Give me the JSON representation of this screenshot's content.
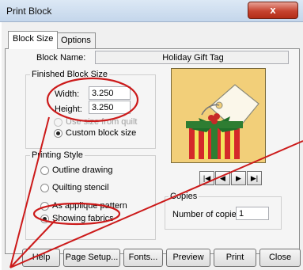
{
  "window": {
    "title": "Print Block",
    "close_glyph": "x"
  },
  "tabs": [
    {
      "label": "Block Size",
      "active": true
    },
    {
      "label": "Options",
      "active": false
    }
  ],
  "block": {
    "name_label": "Block Name:",
    "name_value": "Holiday Gift Tag"
  },
  "finished_size": {
    "legend": "Finished Block Size",
    "width_label": "Width:",
    "width_value": "3.250",
    "height_label": "Height:",
    "height_value": "3.250",
    "use_quilt_label": "Use size from quilt",
    "custom_label": "Custom block size",
    "selected": "custom"
  },
  "printing_style": {
    "legend": "Printing Style",
    "options": [
      "Outline drawing",
      "Quilting stencil",
      "As applique pattern",
      "Showing fabrics"
    ],
    "selected_index": 3
  },
  "navigation": {
    "icons": [
      "first-icon",
      "prev-icon",
      "next-icon",
      "last-icon"
    ]
  },
  "copies": {
    "legend": "Copies",
    "label": "Number of copies:",
    "value": "1"
  },
  "buttons": {
    "help": "Help",
    "page_setup": "Page Setup...",
    "fonts": "Fonts...",
    "preview": "Preview",
    "print": "Print",
    "close": "Close"
  },
  "annotation_color": "#cc1a1a"
}
